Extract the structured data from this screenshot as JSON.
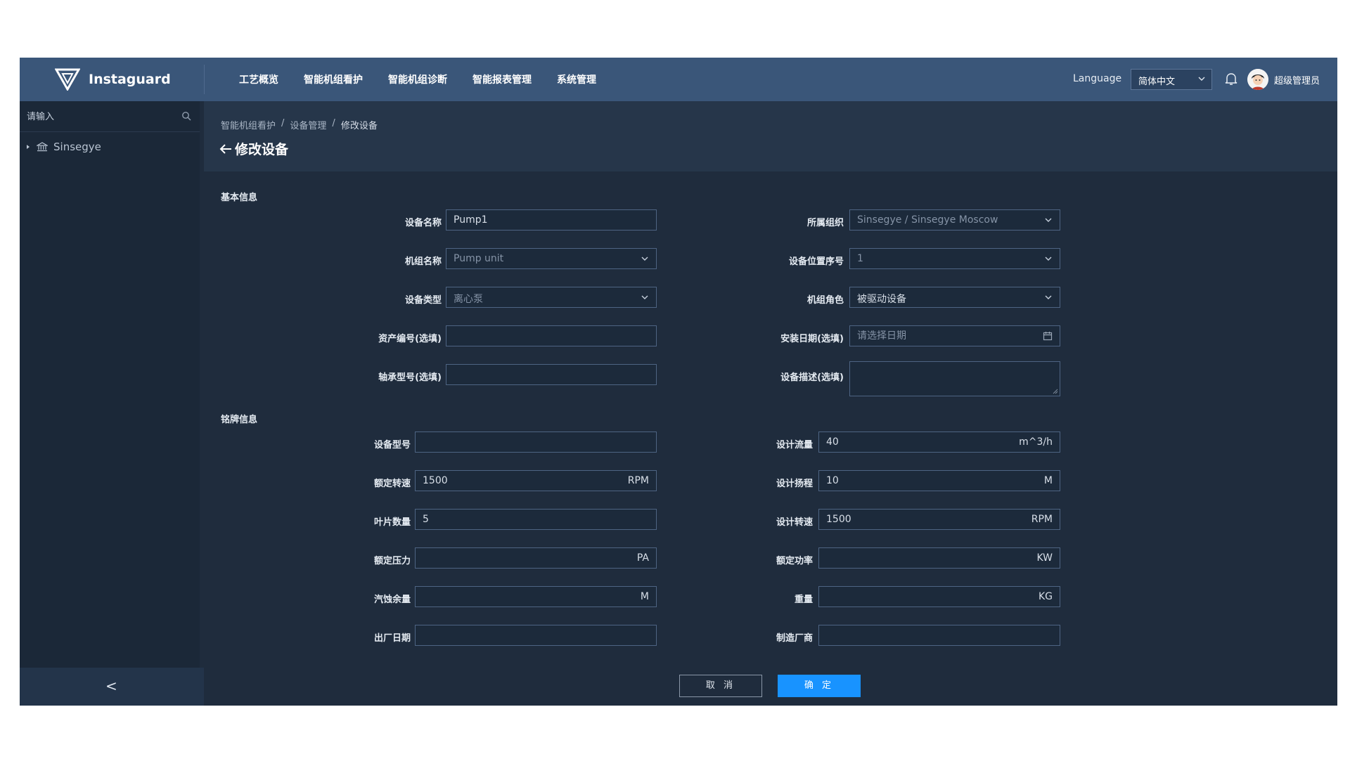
{
  "app": {
    "brand": "Instaguard",
    "menu": [
      "工艺概览",
      "智能机组看护",
      "智能机组诊断",
      "智能报表管理",
      "系统管理"
    ],
    "language_label": "Language",
    "language_value": "简体中文",
    "username": "超级管理员"
  },
  "sidebar": {
    "search_placeholder": "请输入",
    "tree_root": "Sinsegye",
    "collapse_label": "<"
  },
  "breadcrumb": [
    "智能机组看护",
    "设备管理",
    "修改设备"
  ],
  "page_title": "修改设备",
  "basic": {
    "title": "基本信息",
    "device_name_label": "设备名称",
    "device_name": "Pump1",
    "org_label": "所属组织",
    "org": "Sinsegye / Sinsegye Moscow",
    "unit_name_label": "机组名称",
    "unit_name": "Pump unit",
    "position_label": "设备位置序号",
    "position": "1",
    "type_label": "设备类型",
    "type": "离心泵",
    "role_label": "机组角色",
    "role": "被驱动设备",
    "asset_label": "资产编号(选填)",
    "asset": "",
    "install_label": "安装日期(选填)",
    "install_placeholder": "请选择日期",
    "bearing_label": "轴承型号(选填)",
    "bearing": "",
    "desc_label": "设备描述(选填)",
    "desc": ""
  },
  "nameplate": {
    "title": "铭牌信息",
    "model_label": "设备型号",
    "model": "",
    "flow_label": "设计流量",
    "flow": "40",
    "flow_unit": "m^3/h",
    "rated_speed_label": "额定转速",
    "rated_speed": "1500",
    "rated_speed_unit": "RPM",
    "head_label": "设计扬程",
    "head": "10",
    "head_unit": "M",
    "blades_label": "叶片数量",
    "blades": "5",
    "design_speed_label": "设计转速",
    "design_speed": "1500",
    "design_speed_unit": "RPM",
    "pressure_label": "额定压力",
    "pressure": "",
    "pressure_unit": "PA",
    "power_label": "额定功率",
    "power": "",
    "power_unit": "KW",
    "npsh_label": "汽蚀余量",
    "npsh": "",
    "npsh_unit": "M",
    "weight_label": "重量",
    "weight": "",
    "weight_unit": "KG",
    "date_label": "出厂日期",
    "date": "",
    "maker_label": "制造厂商",
    "maker": ""
  },
  "actions": {
    "cancel": "取 消",
    "ok": "确 定"
  },
  "colors": {
    "topbar": "#3a5679",
    "primary": "#1893ff",
    "background": "#1f2c3d"
  }
}
